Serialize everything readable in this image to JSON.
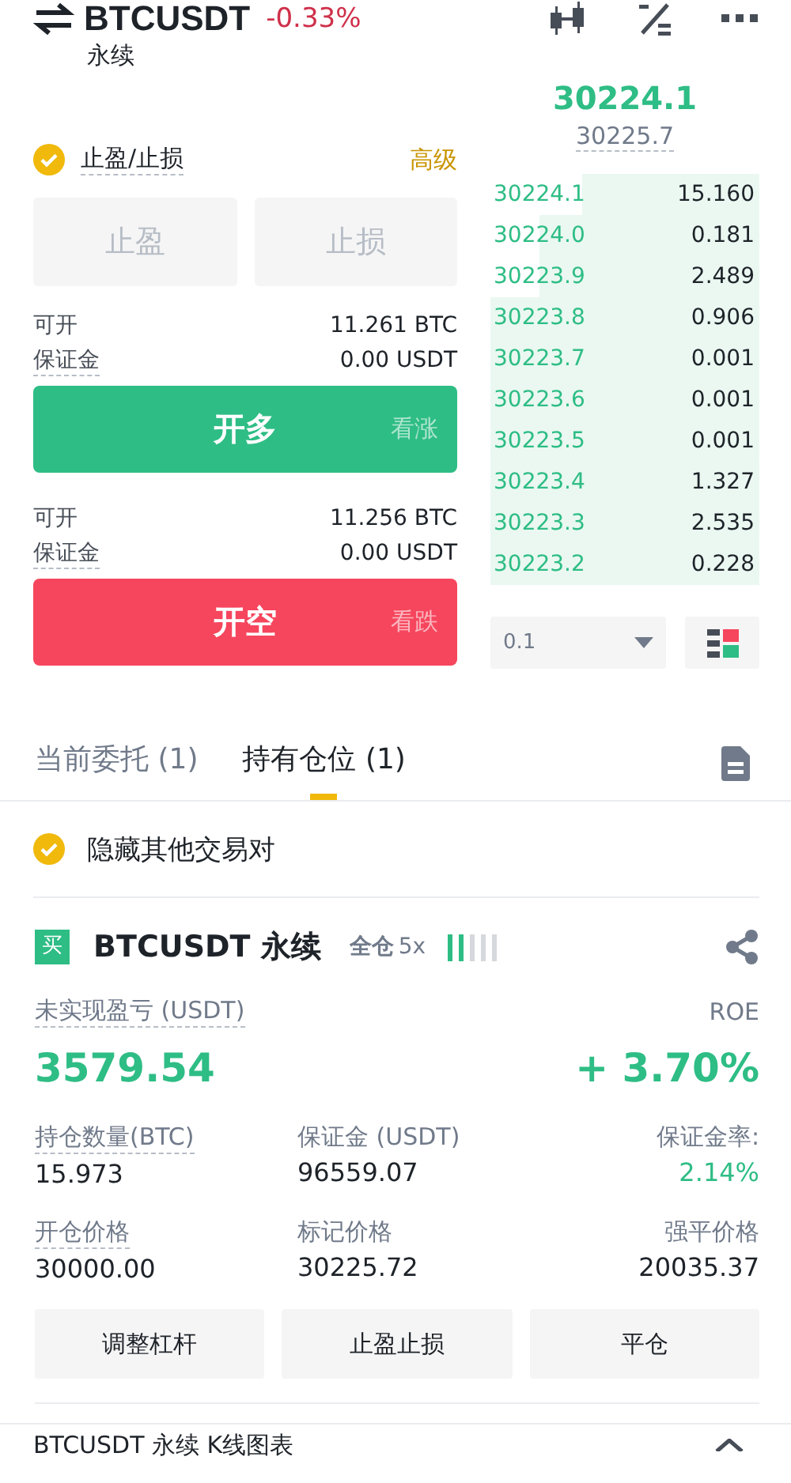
{
  "header": {
    "symbol": "BTCUSDT",
    "change": "-0.33%",
    "contract": "永续"
  },
  "order_form": {
    "tpsl": {
      "label": "止盈/止损",
      "checked": true
    },
    "advanced": "高级",
    "tpsl_buttons": [
      {
        "label": "止盈",
        "disabled": true
      },
      {
        "label": "止损",
        "disabled": true
      }
    ],
    "sides": [
      {
        "kind": "long",
        "rows": [
          {
            "label": "可开",
            "value": "11.261 BTC"
          },
          {
            "label": "保证金",
            "value": "0.00 USDT"
          }
        ],
        "button": "开多",
        "hint": "看涨"
      },
      {
        "kind": "short",
        "rows": [
          {
            "label": "可开",
            "value": "11.256 BTC"
          },
          {
            "label": "保证金",
            "value": "0.00 USDT"
          }
        ],
        "button": "开空",
        "hint": "看跌"
      }
    ]
  },
  "order_book": {
    "last_price": "30224.1",
    "mark_price": "30225.7",
    "precision": "0.1",
    "rows": [
      {
        "price": "30224.1",
        "amount": "15.160"
      },
      {
        "price": "30224.0",
        "amount": "0.181"
      },
      {
        "price": "30223.9",
        "amount": "2.489"
      },
      {
        "price": "30223.8",
        "amount": "0.906"
      },
      {
        "price": "30223.7",
        "amount": "0.001"
      },
      {
        "price": "30223.6",
        "amount": "0.001"
      },
      {
        "price": "30223.5",
        "amount": "0.001"
      },
      {
        "price": "30223.4",
        "amount": "1.327"
      },
      {
        "price": "30223.3",
        "amount": "2.535"
      },
      {
        "price": "30223.2",
        "amount": "0.228"
      }
    ]
  },
  "tabs": [
    {
      "label": "当前委托 (1)",
      "selected": false
    },
    {
      "label": "持有仓位 (1)",
      "selected": true
    }
  ],
  "hide_other_pairs": {
    "label": "隐藏其他交易对",
    "checked": true
  },
  "position": {
    "side": "买",
    "symbol": "BTCUSDT 永续",
    "margin_mode": "全仓",
    "leverage": "5x",
    "risk": {
      "level": 0.4
    },
    "pnl_label": "未实现盈亏 (USDT)",
    "pnl": "3579.54",
    "roe_label": "ROE",
    "roe": "+ 3.70%",
    "fields": [
      {
        "kind": "plain",
        "label": "持仓数量(BTC)",
        "value": "15.973"
      },
      {
        "kind": "plain",
        "label": "保证金 (USDT)",
        "value": "96559.07"
      },
      {
        "kind": "ratio",
        "label": "保证金率:",
        "value": "2.14%"
      },
      {
        "kind": "plain",
        "label": "开仓价格",
        "value": "30000.00"
      },
      {
        "kind": "plain",
        "label": "标记价格",
        "value": "30225.72"
      },
      {
        "kind": "ratio",
        "label": "强平价格",
        "value": "20035.37"
      }
    ],
    "actions": [
      "调整杠杆",
      "止盈止损",
      "平仓"
    ]
  },
  "chart_bar": {
    "title": "BTCUSDT 永续 K线图表"
  }
}
